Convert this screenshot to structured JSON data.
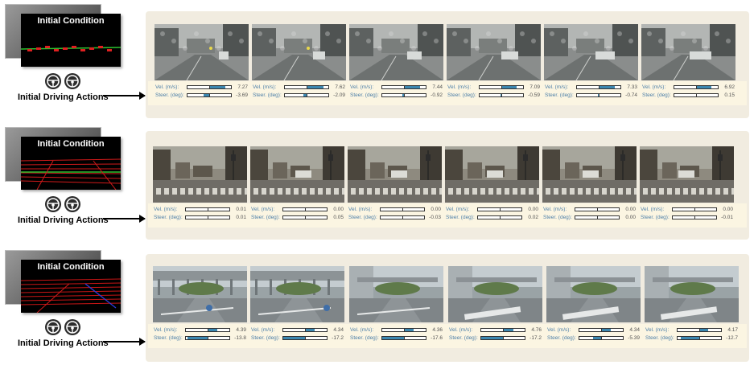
{
  "left_labels": {
    "initial_condition": "Initial Condition",
    "initial_driving_actions": "Initial Driving Actions"
  },
  "stat_labels": {
    "velocity": "Vel. (m/s):",
    "steering": "Steer. (deg):"
  },
  "colors": {
    "row_bg": "#f1ece0",
    "stats_bg": "#fbf5e2",
    "bar_fill": "#3c87b0",
    "label_blue": "#4d7fa8"
  },
  "rows": [
    {
      "scene": "rainy city street",
      "frames": [
        {
          "vel": "7.27",
          "steer": "-3.69",
          "vel_frac": 0.73,
          "steer_frac": -0.25
        },
        {
          "vel": "7.62",
          "steer": "-2.09",
          "vel_frac": 0.76,
          "steer_frac": -0.14
        },
        {
          "vel": "7.44",
          "steer": "-0.92",
          "vel_frac": 0.74,
          "steer_frac": -0.06
        },
        {
          "vel": "7.09",
          "steer": "-0.59",
          "vel_frac": 0.71,
          "steer_frac": -0.04
        },
        {
          "vel": "7.33",
          "steer": "-0.74",
          "vel_frac": 0.73,
          "steer_frac": -0.05
        },
        {
          "vel": "6.92",
          "steer": "0.15",
          "vel_frac": 0.69,
          "steer_frac": 0.01
        }
      ]
    },
    {
      "scene": "intersection with crosswalk",
      "frames": [
        {
          "vel": "0.01",
          "steer": "0.01",
          "vel_frac": 0.0,
          "steer_frac": 0.0
        },
        {
          "vel": "0.00",
          "steer": "0.05",
          "vel_frac": 0.0,
          "steer_frac": 0.0
        },
        {
          "vel": "0.00",
          "steer": "-0.03",
          "vel_frac": 0.0,
          "steer_frac": 0.0
        },
        {
          "vel": "0.00",
          "steer": "0.02",
          "vel_frac": 0.0,
          "steer_frac": 0.0
        },
        {
          "vel": "0.00",
          "steer": "0.00",
          "vel_frac": 0.0,
          "steer_frac": 0.0
        },
        {
          "vel": "0.00",
          "steer": "-0.01",
          "vel_frac": 0.0,
          "steer_frac": 0.0
        }
      ]
    },
    {
      "scene": "turning through plaza",
      "frames": [
        {
          "vel": "4.39",
          "steer": "-13.8",
          "vel_frac": 0.44,
          "steer_frac": -0.92
        },
        {
          "vel": "4.34",
          "steer": "-17.2",
          "vel_frac": 0.43,
          "steer_frac": -1.0
        },
        {
          "vel": "4.36",
          "steer": "-17.6",
          "vel_frac": 0.44,
          "steer_frac": -1.0
        },
        {
          "vel": "4.76",
          "steer": "-17.2",
          "vel_frac": 0.48,
          "steer_frac": -1.0
        },
        {
          "vel": "4.34",
          "steer": "-5.39",
          "vel_frac": 0.43,
          "steer_frac": -0.36
        },
        {
          "vel": "4.17",
          "steer": "-12.7",
          "vel_frac": 0.42,
          "steer_frac": -0.85
        }
      ]
    }
  ]
}
